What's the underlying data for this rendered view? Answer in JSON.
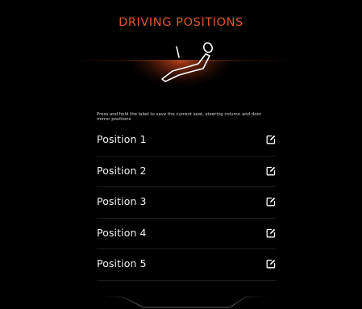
{
  "header": {
    "title": "DRIVING POSITIONS"
  },
  "hero": {
    "icon": "seat-driver-icon",
    "glow_color": "#c2431a"
  },
  "instruction": {
    "text": "Press and hold the label to save the current seat, steering column and door mirror positions"
  },
  "positions": [
    {
      "label": "Position 1",
      "icon": "edit-icon"
    },
    {
      "label": "Position 2",
      "icon": "edit-icon"
    },
    {
      "label": "Position 3",
      "icon": "edit-icon"
    },
    {
      "label": "Position 4",
      "icon": "edit-icon"
    },
    {
      "label": "Position 5",
      "icon": "edit-icon"
    }
  ],
  "colors": {
    "accent": "#e0562a",
    "text": "#f2f2f2",
    "background": "#000000"
  }
}
